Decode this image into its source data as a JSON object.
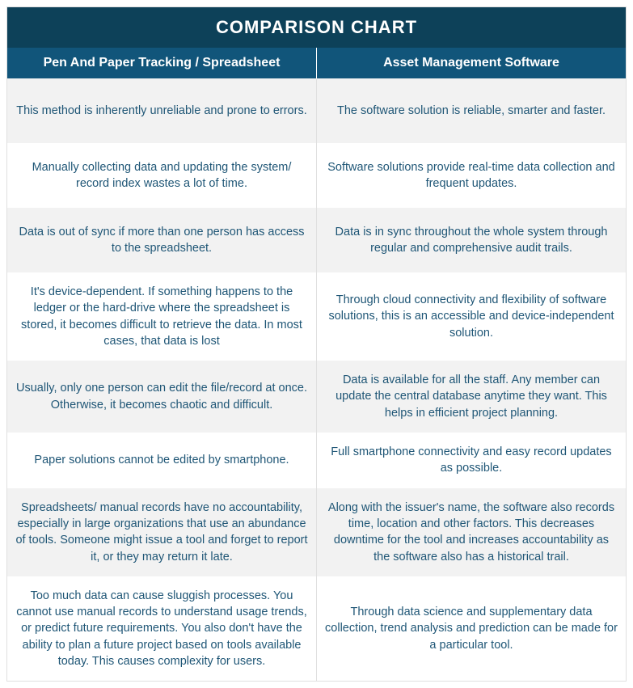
{
  "title": "COMPARISON CHART",
  "headers": {
    "left": "Pen And Paper Tracking / Spreadsheet",
    "right": "Asset Management Software"
  },
  "rows": [
    {
      "left": "This method is inherently unreliable and prone to errors.",
      "right": "The software solution is reliable, smarter and faster."
    },
    {
      "left": "Manually collecting data and updating the system/ record index wastes a lot of time.",
      "right": "Software solutions provide real-time data collection and frequent updates."
    },
    {
      "left": "Data is out of sync if more than one person has access to the spreadsheet.",
      "right": "Data is in sync throughout the whole system through regular and comprehensive audit trails."
    },
    {
      "left": "It's device-dependent. If something happens to the ledger or the hard-drive where the spreadsheet is stored, it becomes difficult to retrieve the data. In most cases, that data is lost",
      "right": "Through cloud connectivity and flexibility of software solutions, this is an accessible and device-independent solution."
    },
    {
      "left": "Usually, only one person can edit the file/record at once. Otherwise, it becomes chaotic and difficult.",
      "right": "Data is available for all the staff. Any member can update the central database anytime they want. This helps in efficient project planning."
    },
    {
      "left": "Paper solutions cannot be edited by smartphone.",
      "right": "Full smartphone connectivity and easy record updates as possible."
    },
    {
      "left": "Spreadsheets/ manual records have no accountability, especially in large organizations that use an abundance of tools. Someone might issue a tool and forget to report it, or they may return it late.",
      "right": "Along with the issuer's name, the software also records time, location and other factors. This decreases downtime for the tool and increases accountability as the software also has a historical trail."
    },
    {
      "left": "Too much data can cause sluggish processes. You cannot use manual records to understand usage trends, or predict future requirements. You also don't have the ability to plan a future project based on tools available today. This causes complexity for users.",
      "right": "Through data science and supplementary data collection, trend analysis and prediction can be made for a particular tool."
    }
  ]
}
